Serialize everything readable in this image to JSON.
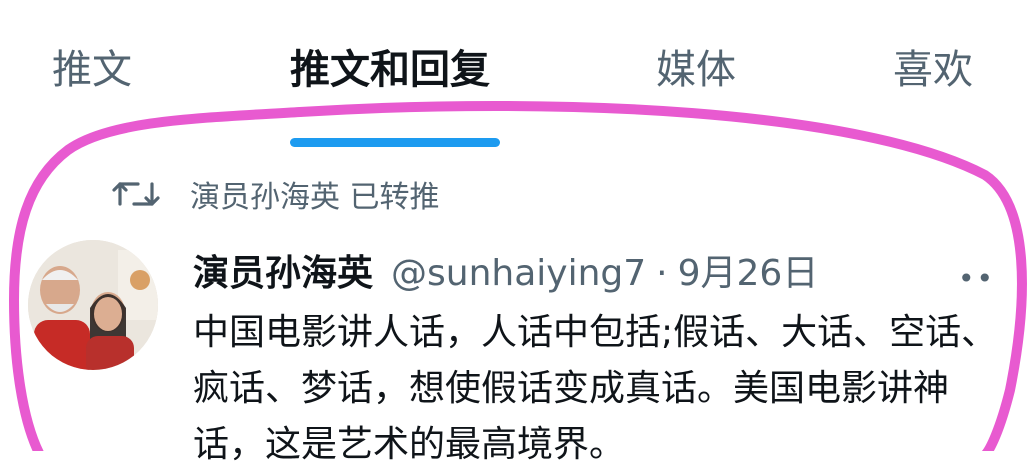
{
  "tabs": [
    {
      "label": "推文",
      "active": false
    },
    {
      "label": "推文和回复",
      "active": true
    },
    {
      "label": "媒体",
      "active": false
    },
    {
      "label": "喜欢",
      "active": false
    }
  ],
  "retweet": {
    "icon": "retweet-icon",
    "text": "演员孙海英 已转推"
  },
  "tweet": {
    "name": "演员孙海英",
    "handle": "@sunhaiying7",
    "separator": "·",
    "date": "9月26日",
    "more_icon": "more-icon",
    "text": "中国电影讲人话，人话中包括;假话、大话、空话、疯话、梦话，想使假话变成真话。美国电影讲神话，这是艺术的最高境界。"
  },
  "colors": {
    "accent": "#1d9bf0",
    "annotation": "#e85ad0",
    "muted": "#536471",
    "text": "#0f1419"
  }
}
